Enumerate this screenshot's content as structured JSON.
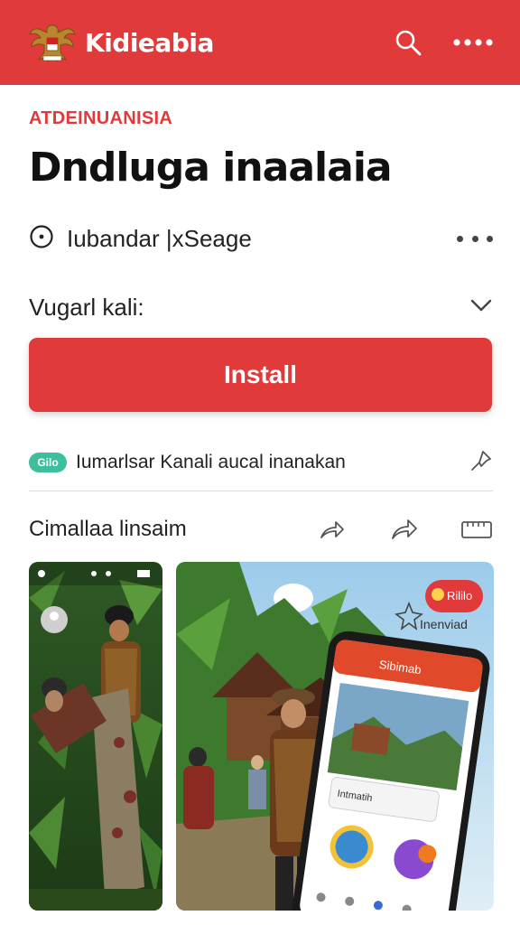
{
  "header": {
    "brand": "Kidieabia",
    "icons": [
      "garuda-logo-icon",
      "search-icon",
      "more-icon"
    ]
  },
  "app": {
    "kicker": "ATDEINUANISIA",
    "title": "Dndluga inaalaia",
    "publisher": "Iubandar |xSeage",
    "version_label": "Vugarl kali:",
    "install_label": "Install"
  },
  "feature": {
    "badge": "Gilo",
    "text": "Iumarlsar Kanali aucal inanakan"
  },
  "screenshots": {
    "section_title": "Cimallaa linsaim",
    "phone_header": "Sibimab",
    "phone_caption": "Intmatih",
    "promo_badge": "Rililo",
    "promo_text": "Inenviad"
  },
  "colors": {
    "accent": "#e03a3a",
    "badge": "#3dbf9e",
    "text": "#222222"
  }
}
